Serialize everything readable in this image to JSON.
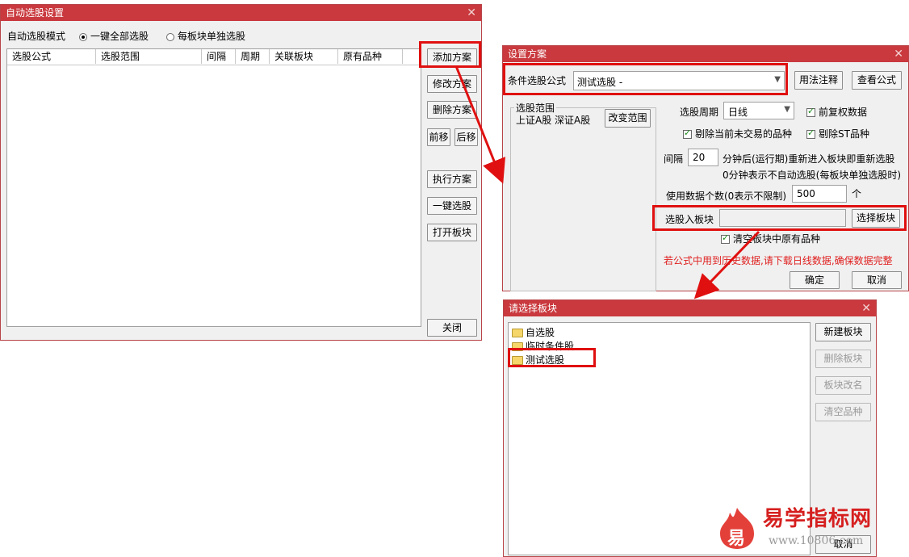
{
  "colors": {
    "title_red": "#c9393e",
    "annotation_red": "#e01010",
    "warning_red": "#e02020"
  },
  "main_window": {
    "title": "自动选股设置",
    "mode_label": "自动选股模式",
    "mode_options": [
      "一键全部选股",
      "每板块单独选股"
    ],
    "mode_selected": "一键全部选股",
    "table_headers": [
      "选股公式",
      "选股范围",
      "间隔",
      "周期",
      "关联板块",
      "原有品种"
    ],
    "buttons": {
      "add": "添加方案",
      "modify": "修改方案",
      "delete": "删除方案",
      "move_up": "前移",
      "move_down": "后移",
      "execute": "执行方案",
      "one_click": "一键选股",
      "open_block": "打开板块",
      "close": "关闭"
    }
  },
  "scheme_dialog": {
    "title": "设置方案",
    "formula_label": "条件选股公式",
    "formula_value": "测试选股      -",
    "usage_button": "用法注释",
    "view_button": "查看公式",
    "range_group": "选股范围",
    "range_value": "上证A股 深证A股",
    "change_range_button": "改变范围",
    "period_label": "选股周期",
    "period_value": "日线",
    "prev_adjust": "前复权数据",
    "exclude_non_trading": "剔除当前未交易的品种",
    "exclude_st": "剔除ST品种",
    "interval_label": "间隔",
    "interval_value": "20",
    "interval_text": "分钟后(运行期)重新进入板块即重新选股",
    "interval_note": "0分钟表示不自动选股(每板块单独选股时)",
    "data_count_label": "使用数据个数(0表示不限制)",
    "data_count_value": "500",
    "data_count_unit": "个",
    "block_label": "选股入板块",
    "block_value": "",
    "select_block_button": "选择板块",
    "clear_block": "清空板块中原有品种",
    "warning": "若公式中用到历史数据,请下载日线数据,确保数据完整",
    "ok": "确定",
    "cancel": "取消"
  },
  "block_dialog": {
    "title": "请选择板块",
    "items": [
      "自选股",
      "临时条件股",
      "测试选股"
    ],
    "buttons": {
      "new": "新建板块",
      "delete": "删除板块",
      "rename": "板块改名",
      "clear": "清空品种",
      "cancel": "取消"
    }
  },
  "watermark": {
    "text": "易学指标网",
    "url": "www.10806.com",
    "logo_char": "易"
  }
}
